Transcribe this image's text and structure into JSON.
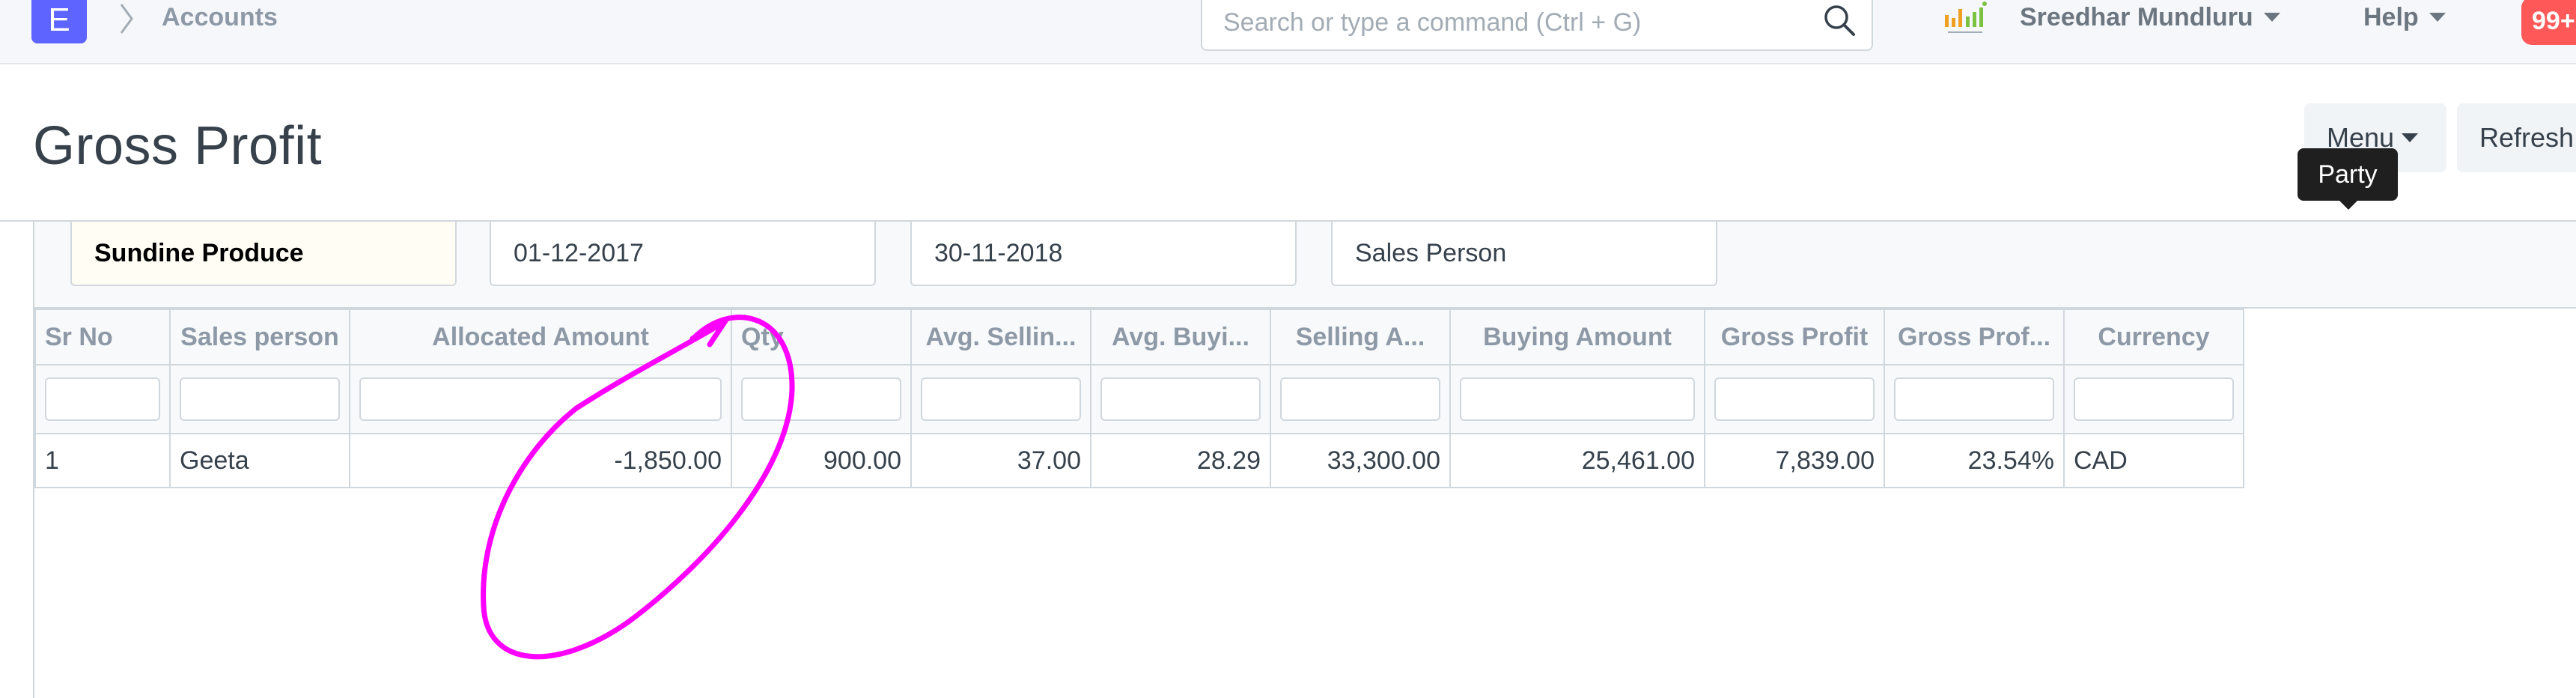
{
  "navbar": {
    "logo_letter": "E",
    "breadcrumb": "Accounts",
    "search_placeholder": "Search or type a command (Ctrl + G)",
    "user_name": "Sreedhar Mundluru",
    "help_label": "Help",
    "notification_count": "99+"
  },
  "page": {
    "title": "Gross Profit",
    "menu_label": "Menu",
    "refresh_label": "Refresh",
    "tooltip": "Party"
  },
  "filters": {
    "company": "Sundine Produce",
    "from_date": "01-12-2017",
    "to_date": "30-11-2018",
    "group_by": "Sales Person"
  },
  "table": {
    "columns": [
      "Sr No",
      "Sales person",
      "Allocated Amount",
      "Qty",
      "Avg. Sellin...",
      "Avg. Buyi...",
      "Selling A...",
      "Buying Amount",
      "Gross Profit",
      "Gross Prof...",
      "Currency"
    ],
    "rows": [
      [
        "1",
        "Geeta",
        "-1,850.00",
        "900.00",
        "37.00",
        "28.29",
        "33,300.00",
        "25,461.00",
        "7,839.00",
        "23.54%",
        "CAD"
      ]
    ]
  },
  "colors": {
    "accent": "#5e64ff",
    "annotation": "#ff00ff",
    "notification": "#ff5858"
  }
}
